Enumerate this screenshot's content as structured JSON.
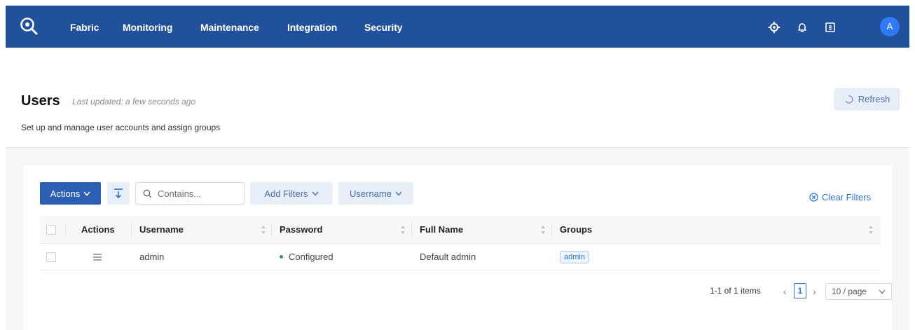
{
  "nav": {
    "items": [
      "Fabric",
      "Monitoring",
      "Maintenance",
      "Integration",
      "Security"
    ],
    "avatar_initial": "A",
    "icons": [
      "gear-icon",
      "bell-icon",
      "panel-icon"
    ]
  },
  "header": {
    "title": "Users",
    "last_updated": "Last updated: a few seconds ago",
    "subtitle": "Set up and manage user accounts and assign groups",
    "refresh_label": "Refresh"
  },
  "toolbar": {
    "actions_label": "Actions",
    "search_placeholder": "Contains...",
    "add_filters_label": "Add Filters",
    "username_filter_label": "Username",
    "clear_filters_label": "Clear Filters"
  },
  "table": {
    "columns": [
      "Actions",
      "Username",
      "Password",
      "Full Name",
      "Groups"
    ],
    "rows": [
      {
        "username": "admin",
        "password": "Configured",
        "full_name": "Default admin",
        "group": "admin"
      }
    ]
  },
  "pagination": {
    "info": "1-1 of 1 items",
    "current_page": "1",
    "page_size": "10 / page"
  },
  "colors": {
    "nav_bg": "#22519b",
    "primary": "#2c5fb3",
    "link": "#2f6fd6",
    "status_ok": "#2e9b3e"
  }
}
